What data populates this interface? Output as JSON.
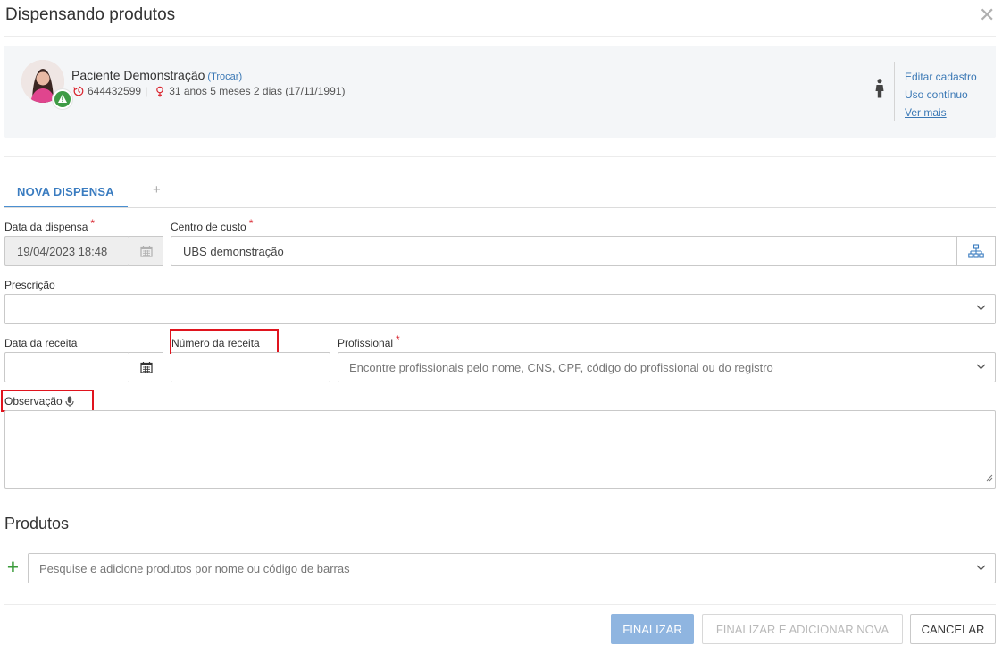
{
  "modal": {
    "title": "Dispensando produtos",
    "close_icon": "close-icon"
  },
  "patient": {
    "name": "Paciente Demonstração",
    "change_link": "(Trocar)",
    "id_number": "644432599",
    "separator": "|",
    "age_text": "31 anos 5 meses 2 dias (17/11/1991)",
    "links": {
      "edit": "Editar cadastro",
      "continuous_use": "Uso contínuo",
      "see_more": "Ver mais"
    }
  },
  "tabs": [
    {
      "label": "NOVA DISPENSA",
      "active": true
    },
    {
      "label": "+"
    }
  ],
  "form": {
    "dispense_date": {
      "label": "Data da dispensa",
      "required_mark": "*",
      "value": "19/04/2023 18:48"
    },
    "cost_center": {
      "label": "Centro de custo",
      "required_mark": "*",
      "value": "UBS demonstração"
    },
    "prescription": {
      "label": "Prescrição",
      "value": ""
    },
    "recipe_date": {
      "label": "Data da receita",
      "value": ""
    },
    "recipe_number": {
      "label": "Número da receita",
      "value": ""
    },
    "professional": {
      "label": "Profissional",
      "required_mark": "*",
      "placeholder": "Encontre profissionais pelo nome, CNS, CPF, código do profissional ou do registro"
    },
    "observation": {
      "label": "Observação",
      "value": ""
    }
  },
  "products": {
    "title": "Produtos",
    "add_symbol": "+",
    "search_placeholder": "Pesquise e adicione produtos por nome ou código de barras"
  },
  "footer": {
    "finish": "FINALIZAR",
    "finish_add_new": "FINALIZAR E ADICIONAR NOVA",
    "cancel": "CANCELAR"
  },
  "colors": {
    "accent": "#3a7cc0",
    "primary_button": "#8fb5e0",
    "required": "#d9232d",
    "highlight_box": "#e0141e",
    "add_green": "#3a9b3a"
  }
}
